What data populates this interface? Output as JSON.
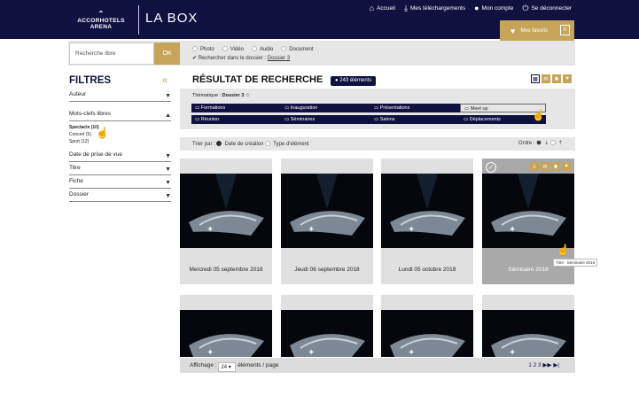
{
  "header": {
    "logo_line1": "ACCORHOTELS",
    "logo_line2": "ARENA",
    "app_title": "LA BOX",
    "nav": [
      {
        "icon": "home-icon",
        "label": "Accueil"
      },
      {
        "icon": "download-icon",
        "label": "Mes téléchargements"
      },
      {
        "icon": "user-icon",
        "label": "Mon compte"
      },
      {
        "icon": "power-icon",
        "label": "Se déconnecter"
      }
    ],
    "favorites_label": "Mes favoris",
    "favorites_count": "0"
  },
  "search": {
    "placeholder": "Recherche libre",
    "ok_label": "OK",
    "types": [
      "Photo",
      "Vidéo",
      "Audio",
      "Document"
    ],
    "in_folder_label": "Rechercher dans le dossier :",
    "in_folder_value": "Dossier 3"
  },
  "filters": {
    "title": "FILTRES",
    "items": [
      "Auteur",
      "Mots-clefs libres",
      "Date de prise de vue",
      "Titre",
      "Fiche",
      "Dossier"
    ],
    "keywords": [
      "Spectacle (10)",
      "Concert (5)",
      "Sport (12)"
    ]
  },
  "results": {
    "title": "RÉSULTAT DE RECHERCHE",
    "count": "243 éléments",
    "thematique_label": "Thématique :",
    "thematique_value": "Dossier 3",
    "tags": [
      "Formations",
      "Inauguration",
      "Présentations",
      "Meet up",
      "Réunion",
      "Séminaires",
      "Salons",
      "Déplacements"
    ],
    "sort_label": "Trier par :",
    "sort_options": [
      "Date de création",
      "Type d'élément"
    ],
    "order_label": "Ordre :",
    "cards": [
      "Mercredi 05 septembre 2018",
      "Jeudi 06 septembre 2018",
      "Lundi 05 octobre 2018",
      "Séminaire 2018"
    ],
    "tooltip": "Titre : Séminaire 2018",
    "display_label": "Affichage :",
    "per_page": "24",
    "per_page_suffix": "éléments / page",
    "pages": "1 2 3"
  }
}
